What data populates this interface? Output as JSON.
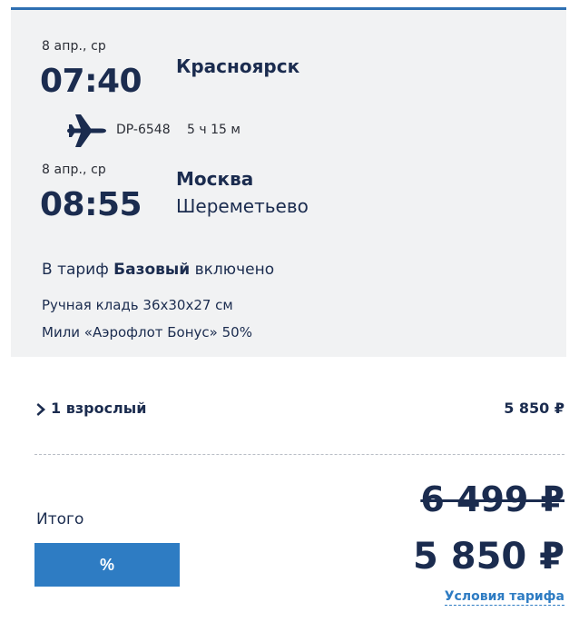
{
  "departure": {
    "date": "8 апр., ср",
    "time": "07:40",
    "city": "Красноярск"
  },
  "flight": {
    "number": "DP-6548",
    "duration": "5 ч 15 м",
    "icon": "airplane-icon"
  },
  "arrival": {
    "date": "8 апр., ср",
    "time": "08:55",
    "city": "Москва",
    "airport": "Шереметьево"
  },
  "tariff": {
    "prefix": "В тариф",
    "name": "Базовый",
    "suffix": "включено",
    "perks": [
      "Ручная кладь 36x30x27 см",
      "Мили «Аэрофлот Бонус» 50%"
    ]
  },
  "passengers": {
    "label": "1 взрослый",
    "price": "5 850 ₽",
    "icon": "chevron-right-icon"
  },
  "total": {
    "label": "Итого",
    "discount_button": "%",
    "old_price": "6 499 ₽",
    "new_price": "5 850 ₽",
    "fare_conditions_link": "Условия тарифа"
  },
  "colors": {
    "accent": "#2e7cc3",
    "text": "#1b2c4f",
    "card_bg": "#f1f2f3"
  }
}
